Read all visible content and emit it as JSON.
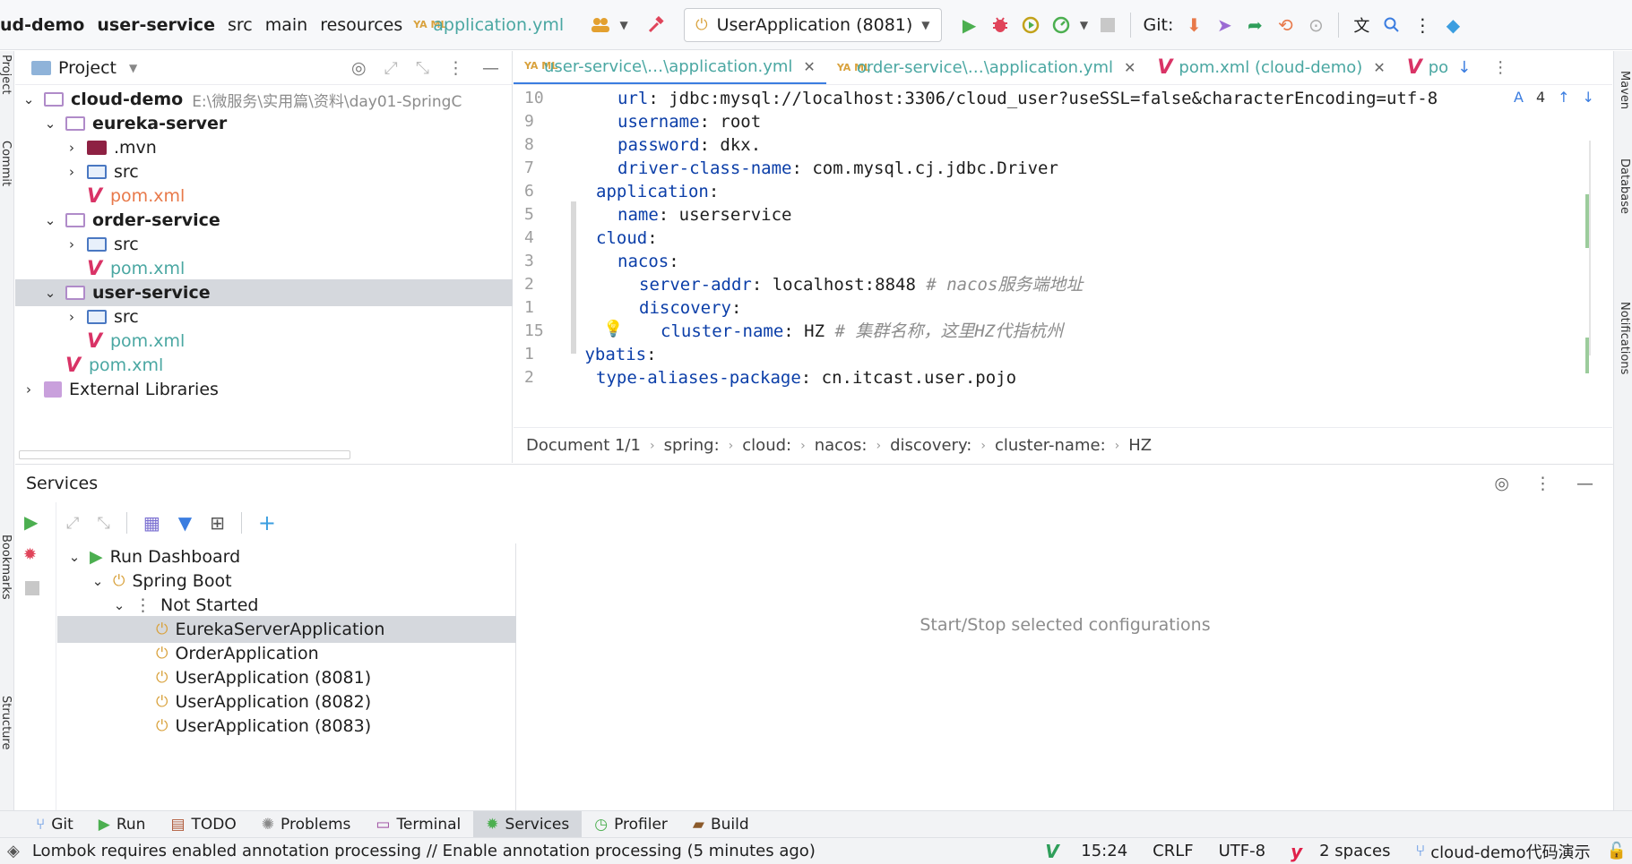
{
  "breadcrumb": {
    "project": "ud-demo",
    "module": "user-service",
    "dir1": "src",
    "dir2": "main",
    "dir3": "resources",
    "file": "application.yml",
    "yml_icon": "YA ML"
  },
  "toolbar": {
    "run_config": "UserApplication (8081)",
    "git_label": "Git:"
  },
  "left_strip": {
    "project": "Project",
    "commit": "Commit",
    "bookmarks": "Bookmarks",
    "structure": "Structure"
  },
  "right_strip": {
    "maven": "Maven",
    "database": "Database",
    "notifications": "Notifications"
  },
  "project_panel": {
    "title": "Project",
    "tree": [
      {
        "label": "cloud-demo",
        "path": "E:\\微服务\\实用篇\\资料\\day01-SpringC"
      },
      {
        "label": "eureka-server"
      },
      {
        "label": ".mvn"
      },
      {
        "label": "src"
      },
      {
        "label": "pom.xml"
      },
      {
        "label": "order-service"
      },
      {
        "label": "src"
      },
      {
        "label": "pom.xml"
      },
      {
        "label": "user-service"
      },
      {
        "label": "src"
      },
      {
        "label": "pom.xml"
      },
      {
        "label": "pom.xml"
      },
      {
        "label": "External Libraries"
      }
    ]
  },
  "editor": {
    "tabs": [
      {
        "label": "user-service\\…\\application.yml"
      },
      {
        "label": "order-service\\…\\application.yml"
      },
      {
        "label": "pom.xml (cloud-demo)"
      },
      {
        "label": "po"
      }
    ],
    "inspection_count": "4",
    "lines": [
      {
        "num": "10",
        "key": "url",
        "value": "jdbc:mysql://localhost:3306/cloud_user?useSSL=false&characterEncoding=utf-8",
        "comment": ""
      },
      {
        "num": "9",
        "key": "username",
        "value": "root",
        "comment": ""
      },
      {
        "num": "8",
        "key": "password",
        "value": "dkx.",
        "comment": ""
      },
      {
        "num": "7",
        "key": "driver-class-name",
        "value": "com.mysql.cj.jdbc.Driver",
        "comment": ""
      },
      {
        "num": "6",
        "key": "application",
        "value": "",
        "comment": ""
      },
      {
        "num": "5",
        "key": "name",
        "value": "userservice",
        "comment": ""
      },
      {
        "num": "4",
        "key": "cloud",
        "value": "",
        "comment": ""
      },
      {
        "num": "3",
        "key": "nacos",
        "value": "",
        "comment": ""
      },
      {
        "num": "2",
        "key": "server-addr",
        "value": "localhost:8848",
        "comment": "# nacos服务端地址"
      },
      {
        "num": "1",
        "key": "discovery",
        "value": "",
        "comment": ""
      },
      {
        "num": "15",
        "key": "cluster-name",
        "value": "HZ",
        "comment": "# 集群名称，这里HZ代指杭州"
      },
      {
        "num": "1",
        "key": "mybatis",
        "value": "",
        "comment": ""
      },
      {
        "num": "2",
        "key": "type-aliases-package",
        "value": "cn.itcast.user.pojo",
        "comment": ""
      }
    ],
    "breadcrumb": [
      "Document 1/1",
      "spring:",
      "cloud:",
      "nacos:",
      "discovery:",
      "cluster-name:",
      "HZ"
    ]
  },
  "services": {
    "title": "Services",
    "tree": [
      {
        "label": "Run Dashboard"
      },
      {
        "label": "Spring Boot"
      },
      {
        "label": "Not Started"
      },
      {
        "label": "EurekaServerApplication"
      },
      {
        "label": "OrderApplication"
      },
      {
        "label": "UserApplication (8081)"
      },
      {
        "label": "UserApplication (8082)"
      },
      {
        "label": "UserApplication (8083)"
      }
    ],
    "empty_hint": "Start/Stop selected configurations"
  },
  "tool_tabs": [
    "Git",
    "Run",
    "TODO",
    "Problems",
    "Terminal",
    "Services",
    "Profiler",
    "Build"
  ],
  "status": {
    "message": "Lombok requires enabled annotation processing // Enable annotation processing (5 minutes ago)",
    "position": "15:24",
    "line_sep": "CRLF",
    "encoding": "UTF-8",
    "indent": "2 spaces",
    "branch": "cloud-demo代码演示"
  },
  "colors": {
    "accent": "#3b7de0",
    "yaml_key": "#0b3ea8",
    "run_green": "#4caf50",
    "debug_red": "#e0445a",
    "selection": "#d5d8dd"
  }
}
